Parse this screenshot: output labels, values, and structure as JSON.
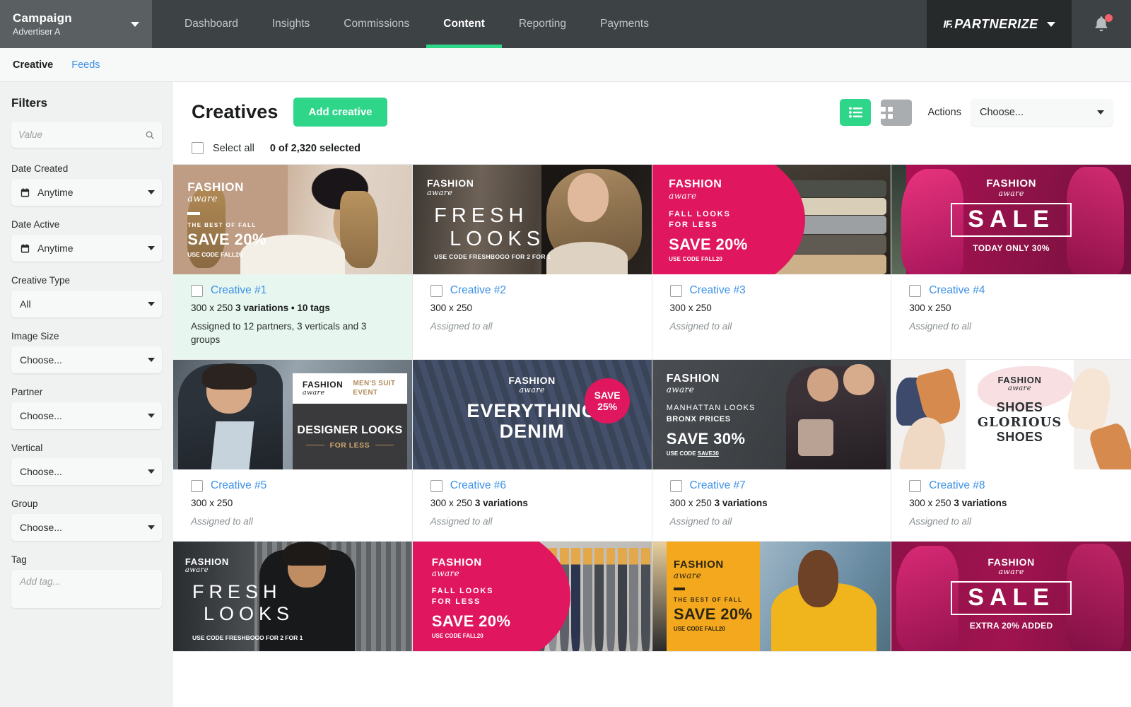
{
  "topnav": {
    "campaign_label": "Campaign",
    "advertiser": "Advertiser A",
    "tabs": [
      {
        "label": "Dashboard",
        "active": false
      },
      {
        "label": "Insights",
        "active": false
      },
      {
        "label": "Commissions",
        "active": false
      },
      {
        "label": "Content",
        "active": true
      },
      {
        "label": "Reporting",
        "active": false
      },
      {
        "label": "Payments",
        "active": false
      }
    ],
    "brand": "PARTNERIZE",
    "brand_mark": "IF.",
    "notification_icon": "bell-icon",
    "notification_badge": true
  },
  "subnav": {
    "items": [
      {
        "label": "Creative",
        "active": true
      },
      {
        "label": "Feeds",
        "active": false
      }
    ]
  },
  "sidebar": {
    "title": "Filters",
    "search_placeholder": "Value",
    "search_value": "",
    "groups": [
      {
        "label": "Date Created",
        "value": "Anytime",
        "icon": "calendar-icon",
        "type": "select"
      },
      {
        "label": "Date Active",
        "value": "Anytime",
        "icon": "calendar-icon",
        "type": "select"
      },
      {
        "label": "Creative Type",
        "value": "All",
        "type": "select"
      },
      {
        "label": "Image Size",
        "value": "Choose...",
        "type": "select"
      },
      {
        "label": "Partner",
        "value": "Choose...",
        "type": "select"
      },
      {
        "label": "Vertical",
        "value": "Choose...",
        "type": "select"
      },
      {
        "label": "Group",
        "value": "Choose...",
        "type": "select"
      }
    ],
    "tag_label": "Tag",
    "tag_placeholder": "Add tag..."
  },
  "main": {
    "title": "Creatives",
    "add_button": "Add creative",
    "view_list_icon": "list-view-icon",
    "view_grid_icon": "grid-view-icon",
    "actions_label": "Actions",
    "actions_value": "Choose...",
    "select_all_label": "Select all",
    "selected_count": "0 of 2,320 selected"
  },
  "colors": {
    "accent_green": "#2fd68a",
    "link_blue": "#3c91e6",
    "nav_dark": "#3d4244",
    "brand_dark": "#262a2b",
    "campaign_gray": "#5a5f61",
    "highlight_mint": "#e7f7ef",
    "badge_red": "#f2606a",
    "brand_pink": "#e0175e",
    "banner_yellow": "#f4a81d"
  },
  "creatives": [
    {
      "name": "Creative #1",
      "dimensions": "300 x 250",
      "variations": "3 variations",
      "tags": "10 tags",
      "separator": "•",
      "assigned": "Assigned to 12 partners, 3 verticals and 3 groups",
      "assigned_style": "dark",
      "highlighted": true,
      "banner": {
        "style": "c1",
        "logo": "FASHION",
        "aware": "aware",
        "kicker": "THE BEST OF FALL",
        "headline": "SAVE 20%",
        "code": "USE CODE FALL20"
      }
    },
    {
      "name": "Creative #2",
      "dimensions": "300 x 250",
      "variations": "",
      "tags": "",
      "assigned": "Assigned to all",
      "assigned_style": "muted",
      "highlighted": false,
      "banner": {
        "style": "c2",
        "logo": "FASHION",
        "aware": "aware",
        "headline_line1": "FRESH",
        "headline_line2": "LOOKS",
        "code": "USE CODE FRESHBOGO FOR 2 FOR 1"
      }
    },
    {
      "name": "Creative #3",
      "dimensions": "300 x 250",
      "variations": "",
      "tags": "",
      "assigned": "Assigned to all",
      "assigned_style": "muted",
      "highlighted": false,
      "banner": {
        "style": "c3",
        "logo": "FASHION",
        "aware": "aware",
        "kicker1": "FALL LOOKS",
        "kicker2": "FOR LESS",
        "headline": "SAVE 20%",
        "code": "USE CODE",
        "code_bold": "FALL20"
      }
    },
    {
      "name": "Creative #4",
      "dimensions": "300 x 250",
      "variations": "",
      "tags": "",
      "assigned": "Assigned to all",
      "assigned_style": "muted",
      "highlighted": false,
      "banner": {
        "style": "c4",
        "logo": "FASHION",
        "aware": "aware",
        "sale": "SALE",
        "subline": "TODAY ONLY 30%"
      }
    },
    {
      "name": "Creative #5",
      "dimensions": "300 x 250",
      "variations": "",
      "tags": "",
      "assigned": "Assigned to all",
      "assigned_style": "muted",
      "highlighted": false,
      "banner": {
        "style": "c5",
        "logo": "FASHION",
        "aware": "aware",
        "event1": "MEN'S SUIT",
        "event2": "EVENT",
        "headline": "DESIGNER LOOKS",
        "subline": "FOR LESS"
      }
    },
    {
      "name": "Creative #6",
      "dimensions": "300 x 250",
      "variations": "3 variations",
      "tags": "",
      "assigned": "Assigned to all",
      "assigned_style": "muted",
      "highlighted": false,
      "banner": {
        "style": "c6",
        "logo": "FASHION",
        "aware": "aware",
        "headline_line1": "EVERYTHING",
        "headline_line2": "DENIM",
        "badge1": "SAVE",
        "badge2": "25%"
      }
    },
    {
      "name": "Creative #7",
      "dimensions": "300 x 250",
      "variations": "3 variations",
      "tags": "",
      "assigned": "Assigned to all",
      "assigned_style": "muted",
      "highlighted": false,
      "banner": {
        "style": "c7",
        "logo": "FASHION",
        "aware": "aware",
        "kicker1": "MANHATTAN LOOKS",
        "kicker2": "BRONX PRICES",
        "headline": "SAVE 30%",
        "code": "USE CODE",
        "code_bold": "SAVE30"
      }
    },
    {
      "name": "Creative #8",
      "dimensions": "300 x 250",
      "variations": "3 variations",
      "tags": "",
      "assigned": "Assigned to all",
      "assigned_style": "muted",
      "highlighted": false,
      "banner": {
        "style": "c8",
        "logo": "FASHION",
        "aware": "aware",
        "line1": "SHOES",
        "line2": "GLORIOUS",
        "line3": "SHOES"
      }
    },
    {
      "name": "",
      "dimensions": "",
      "variations": "",
      "tags": "",
      "assigned": "",
      "assigned_style": "muted",
      "highlighted": false,
      "partial": true,
      "banner": {
        "style": "c9",
        "logo": "FASHION",
        "aware": "aware",
        "headline_line1": "FRESH",
        "headline_line2": "LOOKS",
        "code": "USE CODE FRESHBOGO FOR 2 FOR 1"
      }
    },
    {
      "name": "",
      "dimensions": "",
      "variations": "",
      "tags": "",
      "assigned": "",
      "assigned_style": "muted",
      "highlighted": false,
      "partial": true,
      "banner": {
        "style": "c10",
        "logo": "FASHION",
        "aware": "aware",
        "kicker1": "FALL LOOKS",
        "kicker2": "FOR LESS",
        "headline": "SAVE 20%",
        "code": "USE CODE",
        "code_bold": "FALL20"
      }
    },
    {
      "name": "",
      "dimensions": "",
      "variations": "",
      "tags": "",
      "assigned": "",
      "assigned_style": "muted",
      "highlighted": false,
      "partial": true,
      "banner": {
        "style": "c11",
        "logo": "FASHION",
        "aware": "aware",
        "kicker": "THE BEST OF FALL",
        "headline": "SAVE 20%",
        "code": "USE CODE FALL20"
      }
    },
    {
      "name": "",
      "dimensions": "",
      "variations": "",
      "tags": "",
      "assigned": "",
      "assigned_style": "muted",
      "highlighted": false,
      "partial": true,
      "banner": {
        "style": "c12",
        "logo": "FASHION",
        "aware": "aware",
        "sale": "SALE",
        "subline": "EXTRA 20% ADDED"
      }
    }
  ]
}
